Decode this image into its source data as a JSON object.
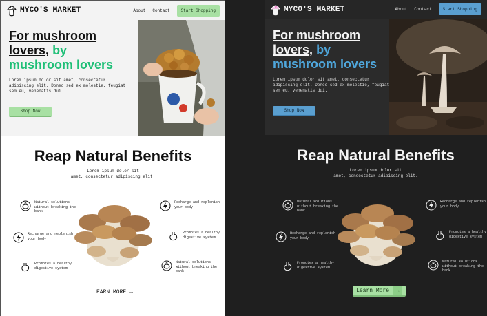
{
  "brand": {
    "name": "MYCO'S MARKET"
  },
  "nav": {
    "about": "About",
    "contact": "Contact",
    "cta": "Start Shopping"
  },
  "hero": {
    "title_part1": "For mushroom lovers",
    "title_comma": ",",
    "title_part2": " by mushroom lovers",
    "body": "Lorem ipsum dolor sit amet, consectetur adipiscing elit. Donec sed ex molestie, feugiat sem eu, venenatis dui.",
    "button": "Shop Now"
  },
  "benefits": {
    "title": "Reap Natural Benefits",
    "subtitle_line1": "Lorem ipsum dolor sit",
    "subtitle_line2": "amet, consectetur adipiscing elit.",
    "features": {
      "natural": "Natural solutions without breaking the bank",
      "recharge": "Recharge and replenish your body",
      "digestive": "Promotes a healthy digestive system"
    },
    "learn_more": "LEARN MORE",
    "learn_more_dark": "Learn More",
    "arrow": "→"
  },
  "colors": {
    "light_accent": "#1fbf77",
    "light_button": "#a8e0a3",
    "dark_accent": "#4fa7dc",
    "dark_button": "#5a9fd0"
  }
}
